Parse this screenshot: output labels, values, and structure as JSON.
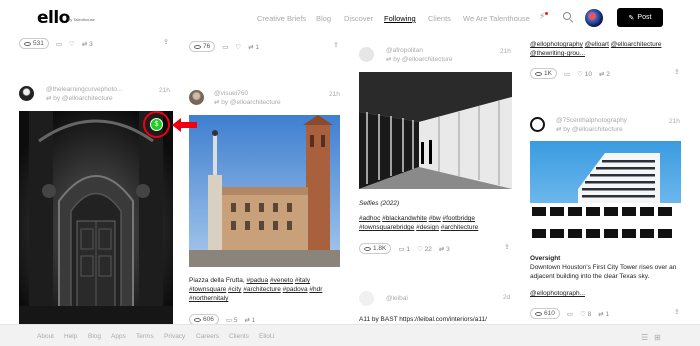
{
  "header": {
    "logo": "ello",
    "logo_sub": "by Talenthouse",
    "nav": [
      "Creative Briefs",
      "Blog",
      "Discover",
      "Following",
      "Clients",
      "We Are Talenthouse"
    ],
    "active_nav": "Following",
    "post_label": "Post"
  },
  "col1": {
    "top_views": "531",
    "top_reposts": "3",
    "author": "@thelearningcurvephoto...",
    "reposted_by": "by @elloarchitecture",
    "time": "21h"
  },
  "col2": {
    "top_views": "76",
    "top_reposts": "1",
    "author": "@visuel760",
    "reposted_by": "by @elloarchitecture",
    "time": "21h",
    "caption_lines": [
      [
        "Piazza della Frutta, ",
        "#padua",
        " ",
        "#veneto",
        " ",
        "#italy"
      ],
      [
        "#townsquare",
        " ",
        "#city",
        " ",
        "#architecture",
        " ",
        "#padova",
        " ",
        "#hdr"
      ],
      [
        "#northernitaly"
      ]
    ],
    "bottom_views": "606",
    "bottom_comments": "5",
    "bottom_reposts": "1"
  },
  "col3": {
    "author": "@afropolitan",
    "reposted_by": "by @elloarchitecture",
    "time": "21h",
    "title": "Selfies (2022)",
    "tags_line1": [
      "#adhoc",
      "#blackandwhite",
      "#bw",
      "#footbridge"
    ],
    "tags_line2": [
      "#townsquarebridge",
      "#design",
      "#architecture"
    ],
    "views": "1.8K",
    "comments": "1",
    "loves": "22",
    "reposts": "3",
    "next_author": "@leibal",
    "next_time": "2d",
    "next_caption": "A11 by BAST https://leibal.com/interiors/a11/"
  },
  "col4": {
    "top_tags_line1": [
      "@ellophotography",
      "@elloart",
      "@elloarchitecture"
    ],
    "top_tags_line2": [
      "@thewriting-grou..."
    ],
    "top_views": "1K",
    "top_loves": "10",
    "top_reposts": "2",
    "author": "@75centhalphotography",
    "reposted_by": "by @elloarchitecture",
    "time": "21h",
    "title": "Oversight",
    "body": "Downtown Houston's First City Tower rises over an adjacent building into the clear Texas sky.",
    "mention": "@ellophotograph...",
    "views": "610",
    "loves": "8",
    "reposts": "1"
  },
  "footer": {
    "links": [
      "About",
      "Help",
      "Blog",
      "Apps",
      "Terms",
      "Privacy",
      "Careers",
      "Clients",
      "ElloU"
    ]
  }
}
